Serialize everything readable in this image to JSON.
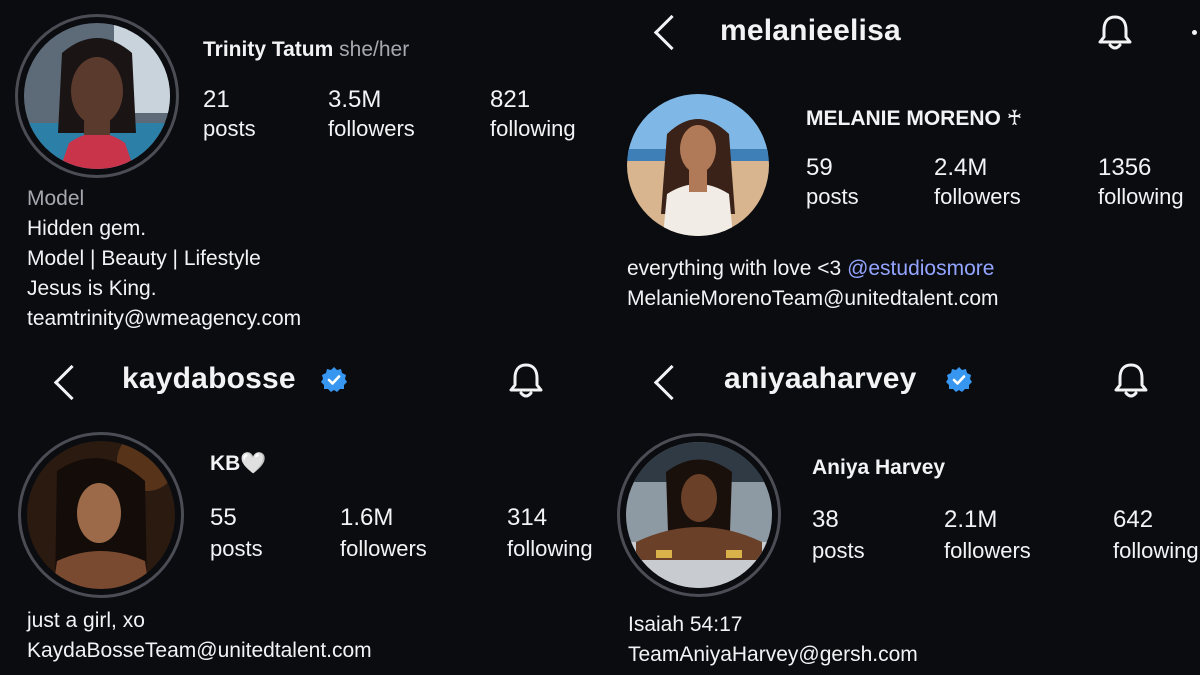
{
  "profiles": [
    {
      "display_name": "Trinity Tatum",
      "pronouns": "she/her",
      "posts": "21",
      "posts_label": "posts",
      "followers": "3.5M",
      "followers_label": "followers",
      "following": "821",
      "following_label": "following",
      "category": "Model",
      "bio": [
        "Hidden gem.",
        "Model | Beauty | Lifestyle",
        "Jesus is King.",
        "teamtrinity@wmeagency.com"
      ]
    },
    {
      "username": "melanieelisa",
      "display_name": "MELANIE MORENO ♰",
      "posts": "59",
      "posts_label": "posts",
      "followers": "2.4M",
      "followers_label": "followers",
      "following": "1356",
      "following_label": "following",
      "bio_text": "everything with love <3",
      "bio_mention": "@estudiosmore",
      "bio_email": "MelanieMorenoTeam@unitedtalent.com"
    },
    {
      "username": "kaydabosse",
      "display_name": "KB🤍",
      "posts": "55",
      "posts_label": "posts",
      "followers": "1.6M",
      "followers_label": "followers",
      "following": "314",
      "following_label": "following",
      "bio": [
        "just a girl, xo",
        "KaydaBosseTeam@unitedtalent.com"
      ]
    },
    {
      "username": "aniyaaharvey",
      "display_name": "Aniya Harvey",
      "posts": "38",
      "posts_label": "posts",
      "followers": "2.1M",
      "followers_label": "followers",
      "following": "642",
      "following_label": "following",
      "bio": [
        "Isaiah 54:17",
        "TeamAniyaHarvey@gersh.com"
      ]
    }
  ],
  "colors": {
    "background": "#0b0c10",
    "text": "#f3f3f5",
    "muted": "#a6a8b0",
    "link": "#93a4ff",
    "verified": "#3797f0"
  }
}
